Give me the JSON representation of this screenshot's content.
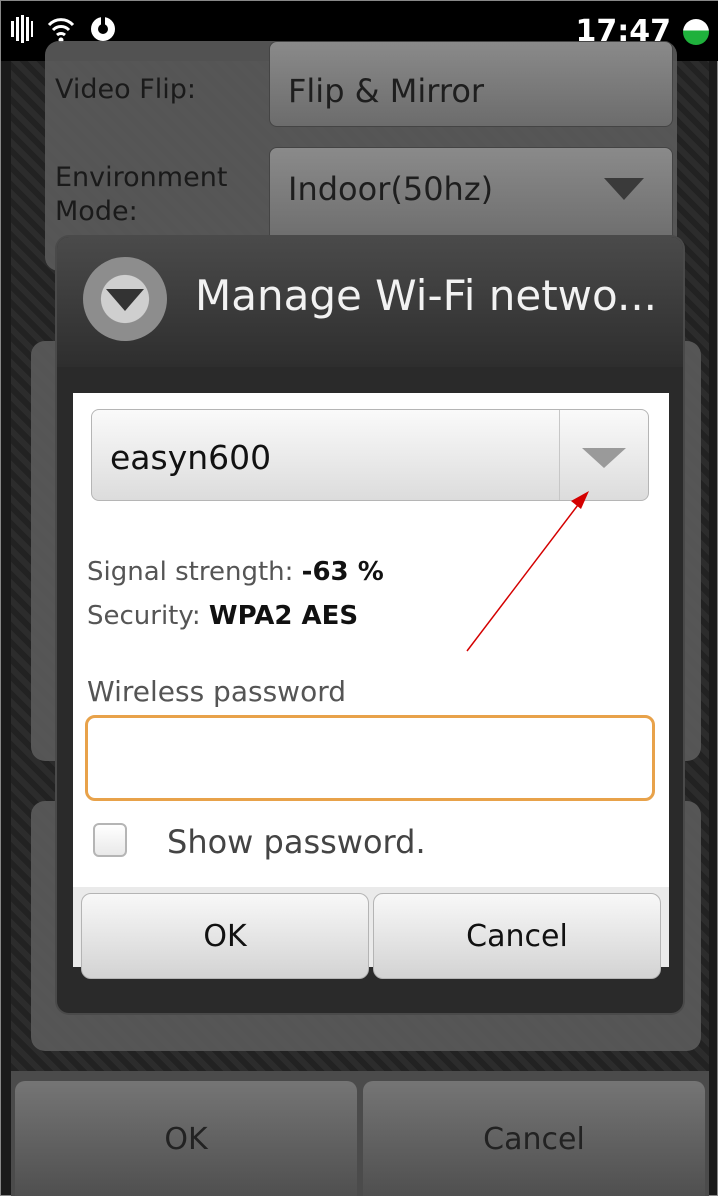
{
  "status_bar": {
    "time": "17:47",
    "icons": [
      "signal-icon",
      "wifi-icon",
      "app-icon",
      "battery-icon"
    ],
    "battery_color": "#1fb13c"
  },
  "background_form": {
    "video_flip_label": "Video Flip:",
    "video_flip_value": "Flip & Mirror",
    "environment_label_line1": "Environment",
    "environment_label_line2": "Mode:",
    "environment_value": "Indoor(50hz)"
  },
  "dialog": {
    "title": "Manage Wi-Fi netwo...",
    "network_select": "easyn600",
    "signal_label": "Signal strength:",
    "signal_value": "-63 %",
    "security_label": "Security:",
    "security_value": "WPA2 AES",
    "password_label": "Wireless password",
    "password_value": "",
    "show_password_label": "Show password.",
    "ok_label": "OK",
    "cancel_label": "Cancel",
    "focus_color": "#e8a24a"
  },
  "bottom_bar": {
    "ok_label": "OK",
    "cancel_label": "Cancel"
  },
  "annotation": {
    "arrow_color": "#d40000"
  }
}
